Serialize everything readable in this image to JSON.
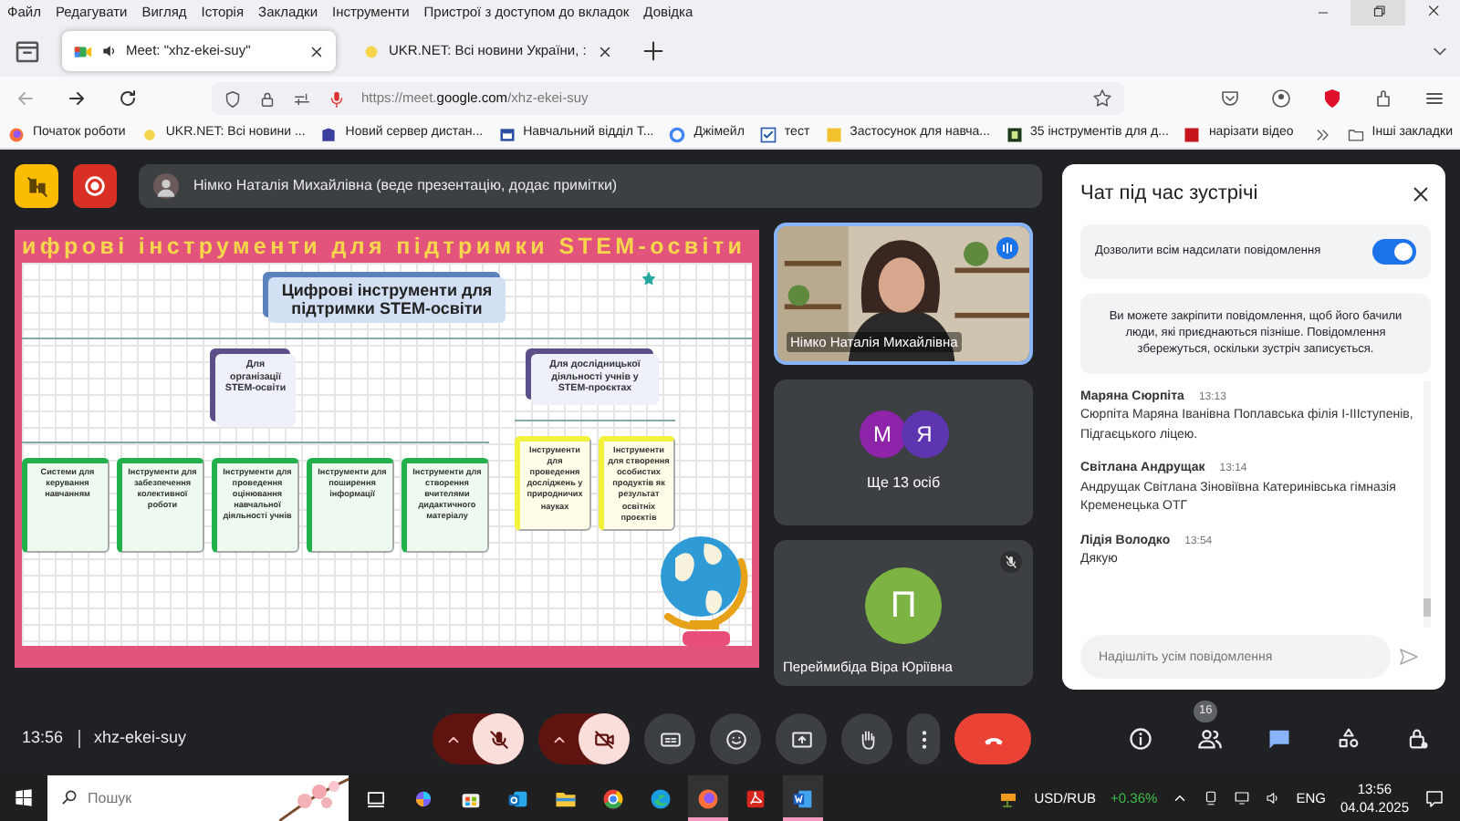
{
  "menu_bar": [
    "Файл",
    "Редагувати",
    "Вигляд",
    "Історія",
    "Закладки",
    "Інструменти",
    "Пристрої з доступом до вкладок",
    "Довідка"
  ],
  "tabs": [
    {
      "label": "Meet: \"xhz-ekei-suy\"",
      "selected": true,
      "audio": true
    },
    {
      "label": "UKR.NET: Всі новини України, :",
      "selected": false,
      "audio": false
    }
  ],
  "address_bar": {
    "url": "https://meet.**google.com**/xhz-ekei-suy"
  },
  "bookmarks": [
    {
      "label": "Початок роботи",
      "kind": "firefox"
    },
    {
      "label": "UKR.NET: Всі новини ...",
      "kind": "sun"
    },
    {
      "label": "Новий сервер дистан...",
      "kind": "building"
    },
    {
      "label": "Навчальний відділ Т...",
      "kind": "calendar"
    },
    {
      "label": "Джімейл",
      "kind": "google"
    },
    {
      "label": "тест",
      "kind": "check"
    },
    {
      "label": "Застосунок для навча...",
      "kind": "tile"
    },
    {
      "label": "35 інструментів для д...",
      "kind": "dark"
    },
    {
      "label": "нарізати відео",
      "kind": "red"
    }
  ],
  "bookmarks_more": "Інші закладки",
  "presenter_banner": "Німко Наталія Михайлівна (веде презентацію, додає примітки)",
  "slide": {
    "title": "ифрові інструменти для підтримки STEM-освіти",
    "root": "Цифрові інструменти для підтримки STEM-освіти",
    "branches": [
      {
        "label": "Для організації STEM-освіти",
        "color": "#22b04b",
        "children": [
          "Системи для керування навчанням",
          "Інструменти для забезпечення колективної роботи",
          "Інструменти для проведення оцінювання навчальної діяльності учнів",
          "Інструменти для поширення інформації",
          "Інструменти для створення вчителями дидактичного матеріалу"
        ]
      },
      {
        "label": "Для дослідницької діяльності учнів у STEM-проєктах",
        "color": "#f2f23a",
        "children": [
          "Інструменти для проведення досліджень у природничих науках",
          "Інструменти для створення особистих продуктів як результат освітніх проєктів"
        ]
      }
    ]
  },
  "tiles": [
    {
      "kind": "video",
      "name": "Німко Наталія Михайлівна",
      "speaking": true
    },
    {
      "kind": "group",
      "avatars": [
        {
          "letter": "М",
          "color": "#8e24aa"
        },
        {
          "letter": "Я",
          "color": "#5e35b1"
        }
      ],
      "label": "Ще 13 осіб"
    },
    {
      "kind": "avatar",
      "letter": "П",
      "color": "#7cb342",
      "name": "Переймибіда Віра Юріївна",
      "muted": true
    }
  ],
  "chat": {
    "title": "Чат під час зустрічі",
    "allow_label": "Дозволити всім надсилати повідомлення",
    "allow_on": true,
    "notice": "Ви можете закріпити повідомлення, щоб його бачили люди, які приєднаються пізніше. Повідомлення збережуться, оскільки зустріч записується.",
    "messages": [
      {
        "sender": "Маряна Сюрпіта",
        "time": "13:13",
        "text": "Сюрпіта Маряна Іванівна Поплавська філія І-ІІІступенів, Підгаєцького ліцею."
      },
      {
        "sender": "Світлана Андрущак",
        "time": "13:14",
        "text": "Андрущак Світлана Зіновіївна Катеринівська гімназія Кременецька ОТГ"
      },
      {
        "sender": "Лідія Володко",
        "time": "13:54",
        "text": "Дякую"
      }
    ],
    "placeholder": "Надішліть усім повідомлення"
  },
  "meeting_bar": {
    "time": "13:56",
    "code": "xhz-ekei-suy",
    "mic_on": false,
    "camera_on": false,
    "people_count": "16",
    "chat_open": true
  },
  "taskbar": {
    "search_placeholder": "Пошук",
    "apps": [
      {
        "kind": "taskview",
        "active": false
      },
      {
        "kind": "copilot",
        "active": false
      },
      {
        "kind": "store",
        "active": false
      },
      {
        "kind": "outlook",
        "active": false
      },
      {
        "kind": "explorer",
        "active": false
      },
      {
        "kind": "chrome",
        "active": false
      },
      {
        "kind": "edge",
        "active": false
      },
      {
        "kind": "firefox",
        "active": true
      },
      {
        "kind": "acrobat",
        "active": false
      },
      {
        "kind": "word",
        "active": true
      }
    ],
    "ticker": "USD/RUB",
    "ticker_change": "+0.36%",
    "language": "ENG",
    "time": "13:56",
    "date": "04.04.2025"
  }
}
